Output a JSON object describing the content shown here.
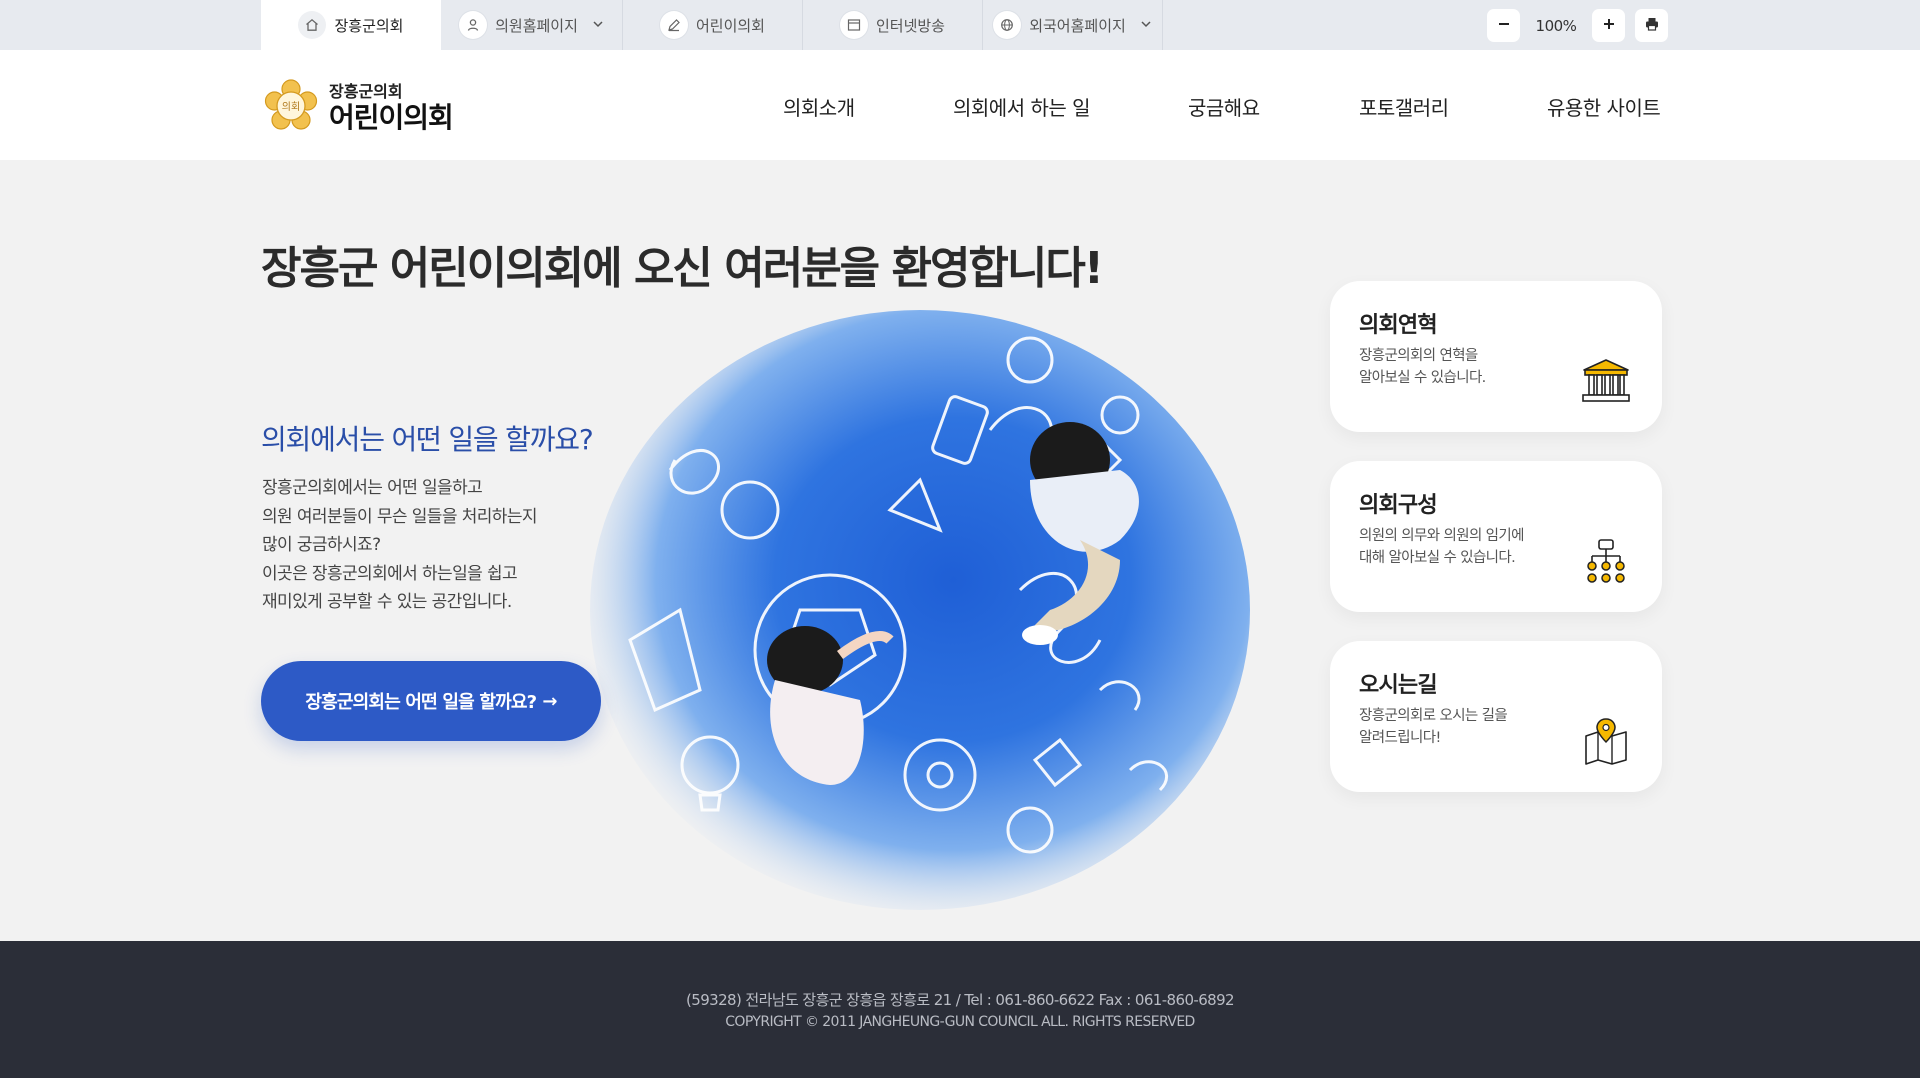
{
  "utility_bar": {
    "tabs": [
      {
        "label": "장흥군의회",
        "icon": "home-icon",
        "active": true
      },
      {
        "label": "의원홈페이지",
        "icon": "person-icon",
        "dropdown": true
      },
      {
        "label": "어린이의회",
        "icon": "pencil-icon"
      },
      {
        "label": "인터넷방송",
        "icon": "browser-window-icon"
      },
      {
        "label": "외국어홈페이지",
        "icon": "globe-icon",
        "dropdown": true
      }
    ],
    "zoom": {
      "level": "100%",
      "decrease_icon": "minus-icon",
      "increase_icon": "plus-icon",
      "print_icon": "printer-icon"
    }
  },
  "header": {
    "logo": {
      "line1": "장흥군의회",
      "line2": "어린이의회",
      "emblem_text": "의회",
      "emblem_color": "#e8b33a"
    },
    "nav": [
      "의회소개",
      "의회에서 하는 일",
      "궁금해요",
      "포토갤러리",
      "유용한 사이트"
    ]
  },
  "main": {
    "welcome": "장흥군 어린이의회에 오신 여러분을 환영합니다!",
    "intro": {
      "title": "의회에서는 어떤 일을 할까요?",
      "lines": [
        "장흥군의회에서는 어떤 일을하고",
        "의원 여러분들이 무슨 일들을 처리하는지",
        "많이 궁금하시죠?",
        "이곳은 장흥군의회에서 하는일을 쉽고",
        "재미있게 공부할 수 있는 공간입니다."
      ],
      "cta_label": "장흥군의회는 어떤 일을 할까요?",
      "cta_arrow": "→"
    },
    "cards": [
      {
        "title": "의회연혁",
        "desc": [
          "장흥군의회의 연혁을",
          "알아보실 수 있습니다."
        ],
        "icon": "building-icon"
      },
      {
        "title": "의회구성",
        "desc": [
          "의원의 의무와 의원의 임기에",
          "대해 알아보실 수 있습니다."
        ],
        "icon": "org-chart-icon"
      },
      {
        "title": "오시는길",
        "desc": [
          "장흥군의회로 오시는 길을",
          "알려드립니다!"
        ],
        "icon": "map-pin-icon"
      }
    ]
  },
  "footer": {
    "address": "(59328) 전라남도 장흥군 장흥읍 장흥로 21 / Tel : 061-860-6622 Fax : 061-860-6892",
    "copyright": "COPYRIGHT © 2011 JANGHEUNG-GUN COUNCIL ALL. RIGHTS RESERVED"
  },
  "colors": {
    "accent": "#2d5ac6",
    "footer_bg": "#2b2e38",
    "page_bg": "#f2f2f2",
    "icon_gold": "#f5b800"
  }
}
